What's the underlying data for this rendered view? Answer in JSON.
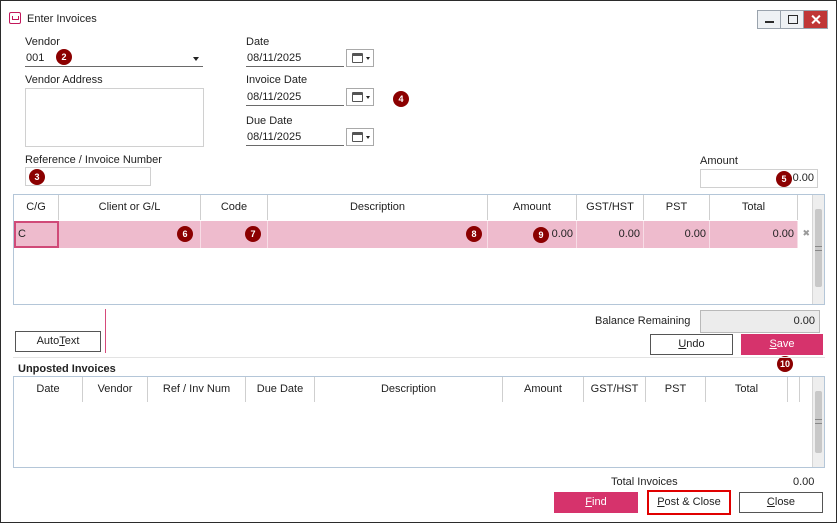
{
  "window": {
    "title": "Enter Invoices"
  },
  "vendor": {
    "label": "Vendor",
    "value": "001"
  },
  "vendor_address": {
    "label": "Vendor Address",
    "value": ""
  },
  "reference": {
    "label": "Reference / Invoice Number",
    "value": ""
  },
  "date": {
    "label": "Date",
    "value": "08/11/2025"
  },
  "invoice_date": {
    "label": "Invoice Date",
    "value": "08/11/2025"
  },
  "due_date": {
    "label": "Due Date",
    "value": "08/11/2025"
  },
  "amount": {
    "label": "Amount",
    "value": "0.00"
  },
  "badges": [
    "2",
    "3",
    "4",
    "5",
    "6",
    "7",
    "8",
    "9",
    "10"
  ],
  "entry_grid": {
    "columns": [
      "C/G",
      "Client or G/L",
      "Code",
      "Description",
      "Amount",
      "GST/HST",
      "PST",
      "Total"
    ],
    "row": {
      "cg": "C",
      "client": "",
      "code": "",
      "description": "",
      "amount": "0.00",
      "gst": "0.00",
      "pst": "0.00",
      "total": "0.00"
    },
    "row_delete_glyph": "✖"
  },
  "balance": {
    "label": "Balance Remaining",
    "value": "0.00"
  },
  "buttons": {
    "autotext": {
      "pre": "Auto",
      "u": "T",
      "post": "ext"
    },
    "undo": {
      "u": "U",
      "post": "ndo"
    },
    "save": {
      "u": "S",
      "post": "ave"
    },
    "find": {
      "u": "F",
      "post": "ind"
    },
    "post_close": {
      "u": "P",
      "post": "ost & Close"
    },
    "close": {
      "u": "C",
      "post": "lose"
    }
  },
  "unposted": {
    "title": "Unposted Invoices",
    "columns": [
      "Date",
      "Vendor",
      "Ref / Inv Num",
      "Due Date",
      "Description",
      "Amount",
      "GST/HST",
      "PST",
      "Total"
    ]
  },
  "totals": {
    "label": "Total Invoices",
    "value": "0.00"
  },
  "colors": {
    "accent": "#d6336c",
    "row_highlight": "#eebbcd",
    "badge": "#8b0000",
    "highlight_border": "#e00000"
  }
}
